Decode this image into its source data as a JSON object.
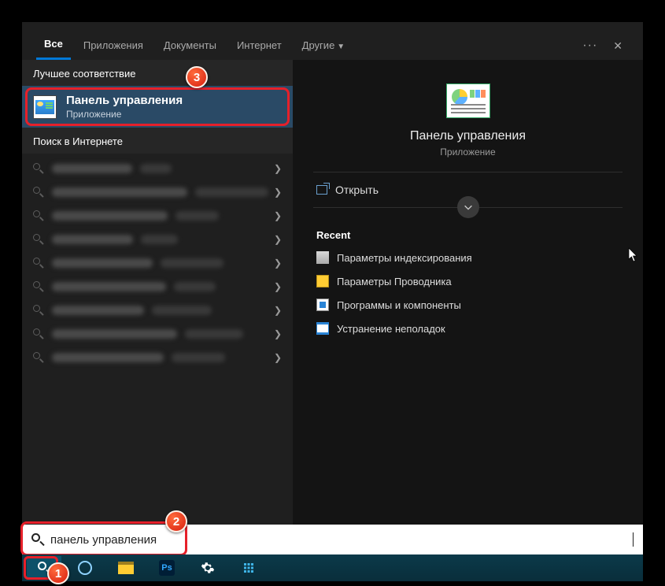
{
  "tabs": {
    "all": "Все",
    "apps": "Приложения",
    "docs": "Документы",
    "internet": "Интернет",
    "other": "Другие"
  },
  "sections": {
    "best_match": "Лучшее соответствие",
    "internet_search": "Поиск в Интернете",
    "recent": "Recent"
  },
  "best_match_item": {
    "title": "Панель управления",
    "subtitle": "Приложение"
  },
  "web_results": [
    {
      "w1": 140,
      "w2": 90
    },
    {
      "w1": 170,
      "w2": 0
    },
    {
      "w1": 150,
      "w2": 40
    },
    {
      "w1": 155,
      "w2": 55
    },
    {
      "w1": 180,
      "w2": 70
    },
    {
      "w1": 160,
      "w2": 60
    },
    {
      "w1": 165,
      "w2": 50
    },
    {
      "w1": 130,
      "w2": 30
    },
    {
      "w1": 155,
      "w2": 85
    }
  ],
  "preview": {
    "title": "Панель управления",
    "subtitle": "Приложение",
    "open": "Открыть"
  },
  "recent_items": [
    {
      "icon": "ri-idx",
      "label": "Параметры индексирования"
    },
    {
      "icon": "ri-expl",
      "label": "Параметры Проводника"
    },
    {
      "icon": "ri-prog",
      "label": "Программы и компоненты"
    },
    {
      "icon": "ri-troub",
      "label": "Устранение неполадок"
    }
  ],
  "search": {
    "value": "панель управления",
    "placeholder": ""
  },
  "badges": {
    "b1": "1",
    "b2": "2",
    "b3": "3"
  },
  "taskbar": {
    "ps": "Ps"
  }
}
